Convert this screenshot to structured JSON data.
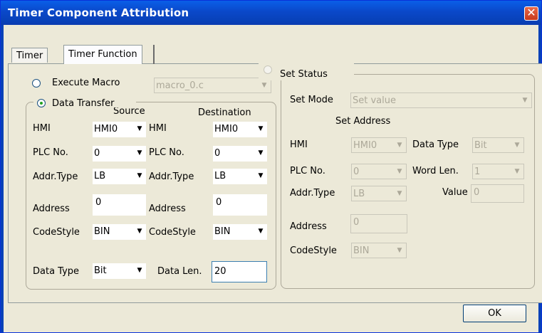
{
  "window": {
    "title": "Timer Component Attribution",
    "close_glyph": "✕"
  },
  "tabs": [
    {
      "label": "Timer",
      "selected": false
    },
    {
      "label": "Timer Function",
      "selected": true
    }
  ],
  "execute_macro": {
    "label": "Execute Macro",
    "selected": false,
    "macro_value": "macro_0.c"
  },
  "data_transfer": {
    "label": "Data Transfer",
    "selected": true,
    "source_header": "Source",
    "destination_header": "Destination",
    "source": {
      "hmi_label": "HMI",
      "hmi_value": "HMI0",
      "plc_label": "PLC No.",
      "plc_value": "0",
      "addr_type_label": "Addr.Type",
      "addr_type_value": "LB",
      "address_label": "Address",
      "address_value": "0",
      "codestyle_label": "CodeStyle",
      "codestyle_value": "BIN"
    },
    "destination": {
      "hmi_label": "HMI",
      "hmi_value": "HMI0",
      "plc_label": "PLC No.",
      "plc_value": "0",
      "addr_type_label": "Addr.Type",
      "addr_type_value": "LB",
      "address_label": "Address",
      "address_value": "0",
      "codestyle_label": "CodeStyle",
      "codestyle_value": "BIN"
    },
    "data_type_label": "Data Type",
    "data_type_value": "Bit",
    "data_len_label": "Data Len.",
    "data_len_value": "20"
  },
  "set_status": {
    "label": "Set Status",
    "selected": false,
    "set_mode_label": "Set Mode",
    "set_mode_value": "Set value",
    "set_address_header": "Set Address",
    "hmi_label": "HMI",
    "hmi_value": "HMI0",
    "data_type_label": "Data Type",
    "data_type_value": "Bit",
    "plc_label": "PLC No.",
    "plc_value": "0",
    "word_len_label": "Word Len.",
    "word_len_value": "1",
    "addr_type_label": "Addr.Type",
    "addr_type_value": "LB",
    "value_label": "Value",
    "value_value": "0",
    "address_label": "Address",
    "address_value": "0",
    "codestyle_label": "CodeStyle",
    "codestyle_value": "BIN"
  },
  "ok_label": "OK",
  "dropdown_arrow": "▼"
}
